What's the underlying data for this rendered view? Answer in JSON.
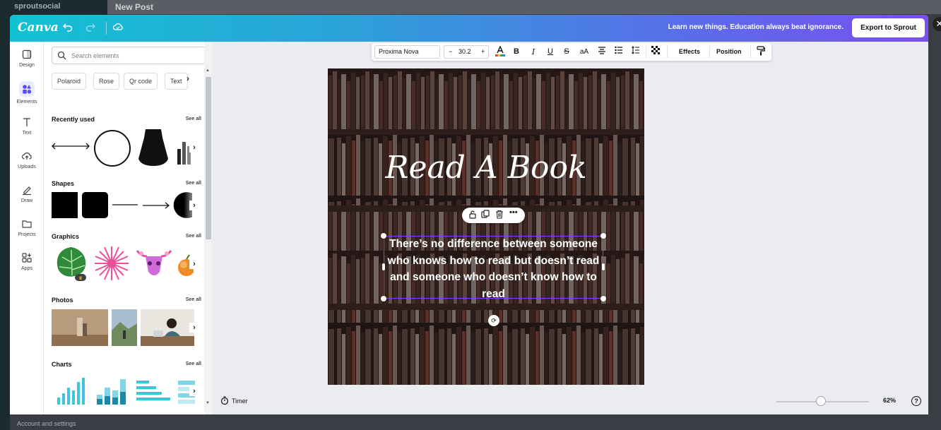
{
  "background": {
    "app_logo": "sproutsocial",
    "page_title": "New Post",
    "bottom_text": "Account and settings"
  },
  "topbar": {
    "logo": "Canva",
    "motto": "Learn new things. Education always beat ignorance.",
    "export_label": "Export to Sprout",
    "icons": [
      "undo-icon",
      "redo-icon",
      "cloud-sync-icon"
    ]
  },
  "rail": {
    "items": [
      {
        "label": "Design",
        "icon": "design-icon"
      },
      {
        "label": "Elements",
        "icon": "elements-icon"
      },
      {
        "label": "Text",
        "icon": "text-icon"
      },
      {
        "label": "Uploads",
        "icon": "upload-icon"
      },
      {
        "label": "Draw",
        "icon": "draw-icon"
      },
      {
        "label": "Projects",
        "icon": "folder-icon"
      },
      {
        "label": "Apps",
        "icon": "apps-icon"
      }
    ]
  },
  "panel": {
    "search_placeholder": "Search elements",
    "chips": [
      "Polaroid",
      "Rose",
      "Qr code",
      "Text"
    ],
    "see_all": "See all",
    "sections": [
      "Recently used",
      "Shapes",
      "Graphics",
      "Photos",
      "Charts"
    ]
  },
  "toolbar": {
    "font": "Proxima Nova",
    "minus": "−",
    "size": "30.2",
    "plus": "+",
    "bold": "B",
    "italic": "I",
    "underline": "U",
    "strike": "S",
    "case": "aA",
    "effects": "Effects",
    "position": "Position"
  },
  "canvas": {
    "heading": "Read A Book",
    "quote": "There’s no difference between someone who knows how to read but doesn’t read and someone who doesn’t know how to read"
  },
  "bottom": {
    "timer": "Timer",
    "zoom": "62%",
    "zoom_fraction": 0.62,
    "help": "?"
  }
}
